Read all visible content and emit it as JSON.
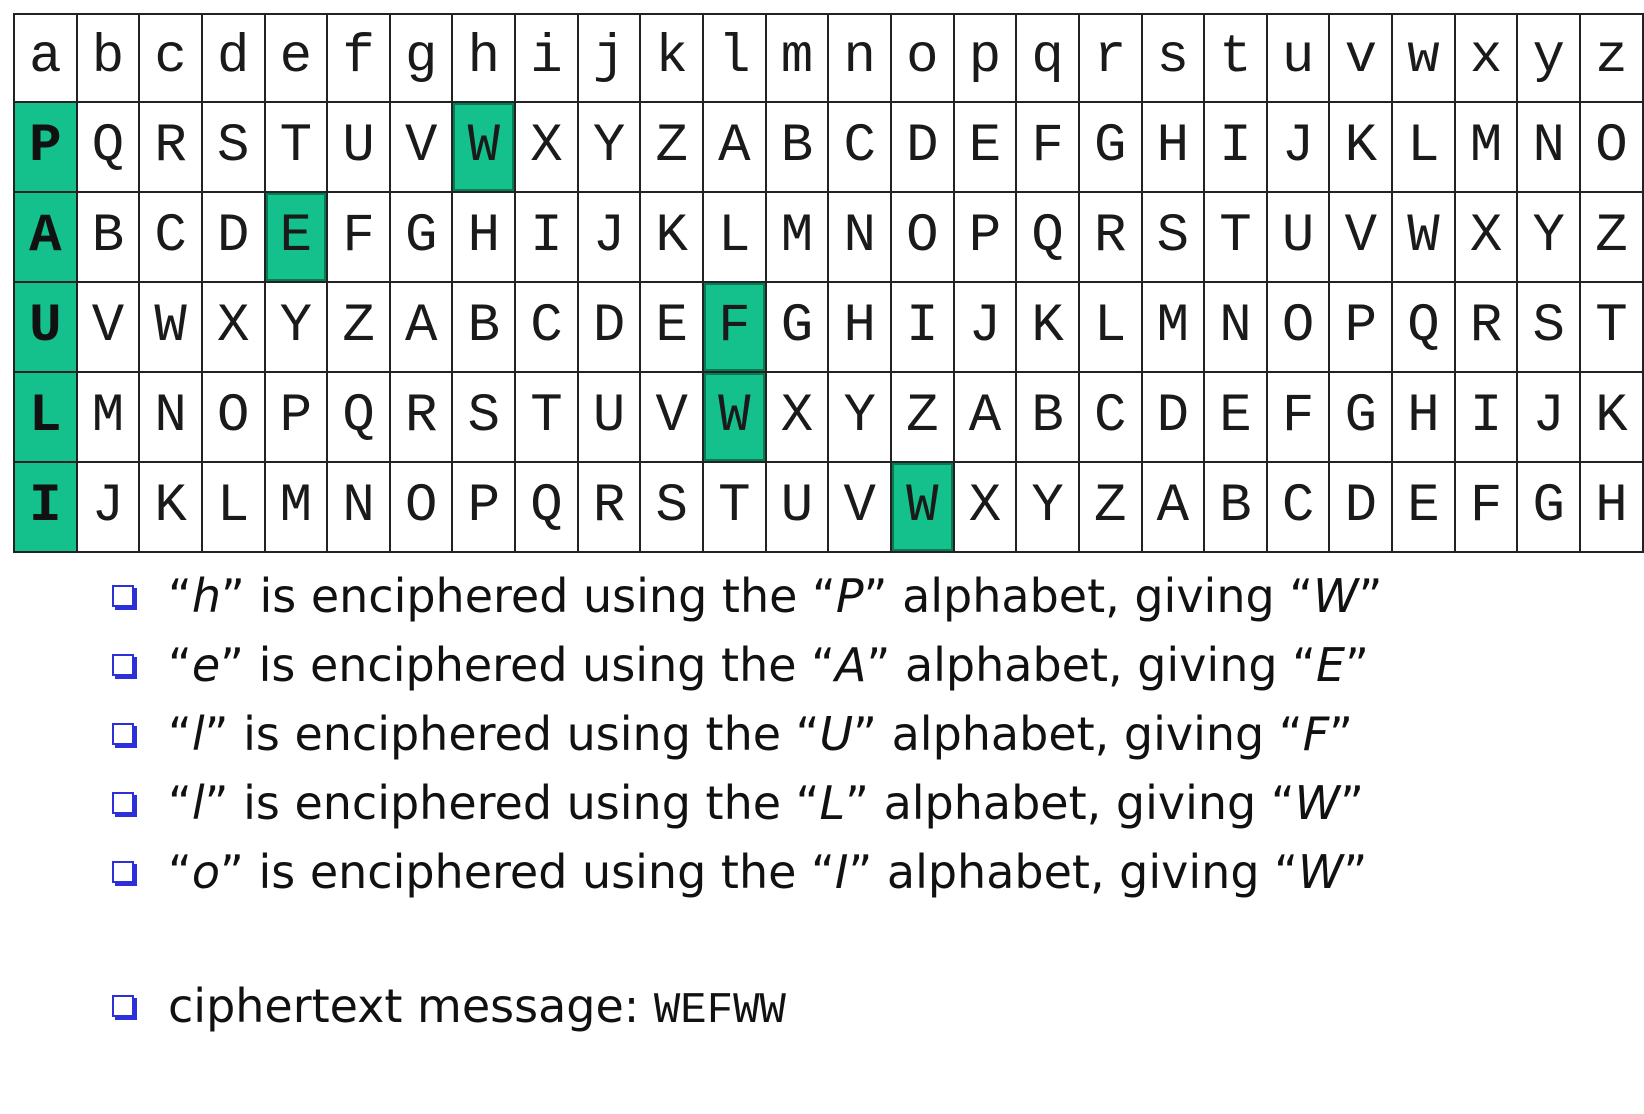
{
  "colors": {
    "highlight": "#14c08b",
    "bullet": "#2d2fd8",
    "grid": "#222222"
  },
  "plain_alphabet": [
    "a",
    "b",
    "c",
    "d",
    "e",
    "f",
    "g",
    "h",
    "i",
    "j",
    "k",
    "l",
    "m",
    "n",
    "o",
    "p",
    "q",
    "r",
    "s",
    "t",
    "u",
    "v",
    "w",
    "x",
    "y",
    "z"
  ],
  "rows": [
    {
      "key": "P",
      "letters": [
        "Q",
        "R",
        "S",
        "T",
        "U",
        "V",
        "W",
        "X",
        "Y",
        "Z",
        "A",
        "B",
        "C",
        "D",
        "E",
        "F",
        "G",
        "H",
        "I",
        "J",
        "K",
        "L",
        "M",
        "N",
        "O"
      ],
      "highlight_index": 6
    },
    {
      "key": "A",
      "letters": [
        "B",
        "C",
        "D",
        "E",
        "F",
        "G",
        "H",
        "I",
        "J",
        "K",
        "L",
        "M",
        "N",
        "O",
        "P",
        "Q",
        "R",
        "S",
        "T",
        "U",
        "V",
        "W",
        "X",
        "Y",
        "Z"
      ],
      "highlight_index": 3
    },
    {
      "key": "U",
      "letters": [
        "V",
        "W",
        "X",
        "Y",
        "Z",
        "A",
        "B",
        "C",
        "D",
        "E",
        "F",
        "G",
        "H",
        "I",
        "J",
        "K",
        "L",
        "M",
        "N",
        "O",
        "P",
        "Q",
        "R",
        "S",
        "T"
      ],
      "highlight_index": 10
    },
    {
      "key": "L",
      "letters": [
        "M",
        "N",
        "O",
        "P",
        "Q",
        "R",
        "S",
        "T",
        "U",
        "V",
        "W",
        "X",
        "Y",
        "Z",
        "A",
        "B",
        "C",
        "D",
        "E",
        "F",
        "G",
        "H",
        "I",
        "J",
        "K"
      ],
      "highlight_index": 10
    },
    {
      "key": "I",
      "letters": [
        "J",
        "K",
        "L",
        "M",
        "N",
        "O",
        "P",
        "Q",
        "R",
        "S",
        "T",
        "U",
        "V",
        "W",
        "X",
        "Y",
        "Z",
        "A",
        "B",
        "C",
        "D",
        "E",
        "F",
        "G",
        "H"
      ],
      "highlight_index": 13
    }
  ],
  "bullets": [
    {
      "parts": [
        "“",
        "h",
        "” is enciphered using the “",
        "P",
        "” alphabet, giving “",
        "W",
        "”"
      ]
    },
    {
      "parts": [
        "“",
        "e",
        "” is enciphered using the “",
        "A",
        "” alphabet, giving “",
        "E",
        "”"
      ]
    },
    {
      "parts": [
        "“",
        "l",
        "” is enciphered using the “",
        "U",
        "” alphabet, giving “",
        "F",
        "”"
      ]
    },
    {
      "parts": [
        "“",
        "l",
        "” is enciphered using the “",
        "L",
        "” alphabet, giving “",
        "W",
        "”"
      ]
    },
    {
      "parts": [
        "“",
        "o",
        "” is enciphered using the “",
        "I",
        "” alphabet, giving “",
        "W",
        "”"
      ]
    }
  ],
  "ciphertext": {
    "label": "ciphertext message:",
    "value": "WEFWW"
  }
}
